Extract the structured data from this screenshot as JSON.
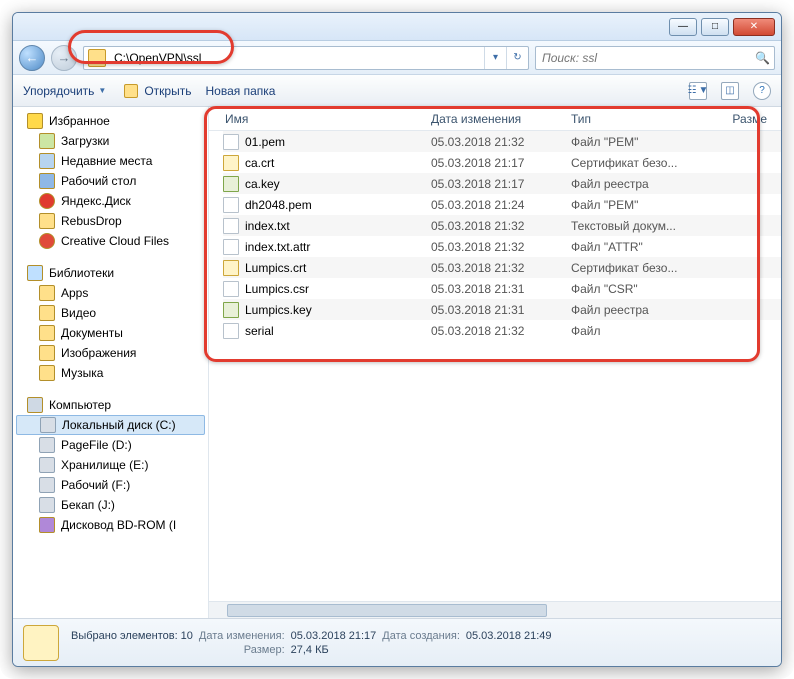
{
  "address": "C:\\OpenVPN\\ssl",
  "search_placeholder": "Поиск: ssl",
  "toolbar": {
    "organize": "Упорядочить",
    "open": "Открыть",
    "new_folder": "Новая папка"
  },
  "columns": {
    "name": "Имя",
    "date": "Дата изменения",
    "type": "Тип",
    "size": "Разме"
  },
  "nav": {
    "favorites": "Избранное",
    "fav_items": [
      "Загрузки",
      "Недавние места",
      "Рабочий стол",
      "Яндекс.Диск",
      "RebusDrop",
      "Creative Cloud Files"
    ],
    "libraries": "Библиотеки",
    "lib_items": [
      "Apps",
      "Видео",
      "Документы",
      "Изображения",
      "Музыка"
    ],
    "computer": "Компьютер",
    "drives": [
      "Локальный диск (C:)",
      "PageFile (D:)",
      "Хранилище (E:)",
      "Рабочий (F:)",
      "Бекап (J:)",
      "Дисковод BD-ROM (I"
    ]
  },
  "files": [
    {
      "name": "01.pem",
      "date": "05.03.2018 21:32",
      "type": "Файл \"PEM\"",
      "ico": ""
    },
    {
      "name": "ca.crt",
      "date": "05.03.2018 21:17",
      "type": "Сертификат безо...",
      "ico": "crt"
    },
    {
      "name": "ca.key",
      "date": "05.03.2018 21:17",
      "type": "Файл реестра",
      "ico": "key"
    },
    {
      "name": "dh2048.pem",
      "date": "05.03.2018 21:24",
      "type": "Файл \"PEM\"",
      "ico": ""
    },
    {
      "name": "index.txt",
      "date": "05.03.2018 21:32",
      "type": "Текстовый докум...",
      "ico": ""
    },
    {
      "name": "index.txt.attr",
      "date": "05.03.2018 21:32",
      "type": "Файл \"ATTR\"",
      "ico": ""
    },
    {
      "name": "Lumpics.crt",
      "date": "05.03.2018 21:32",
      "type": "Сертификат безо...",
      "ico": "crt"
    },
    {
      "name": "Lumpics.csr",
      "date": "05.03.2018 21:31",
      "type": "Файл \"CSR\"",
      "ico": ""
    },
    {
      "name": "Lumpics.key",
      "date": "05.03.2018 21:31",
      "type": "Файл реестра",
      "ico": "key"
    },
    {
      "name": "serial",
      "date": "05.03.2018 21:32",
      "type": "Файл",
      "ico": ""
    }
  ],
  "status": {
    "title": "Выбрано элементов: 10",
    "date_mod_lbl": "Дата изменения:",
    "date_mod": "05.03.2018 21:17",
    "date_cre_lbl": "Дата создания:",
    "date_cre": "05.03.2018 21:49",
    "size_lbl": "Размер:",
    "size": "27,4 КБ"
  }
}
